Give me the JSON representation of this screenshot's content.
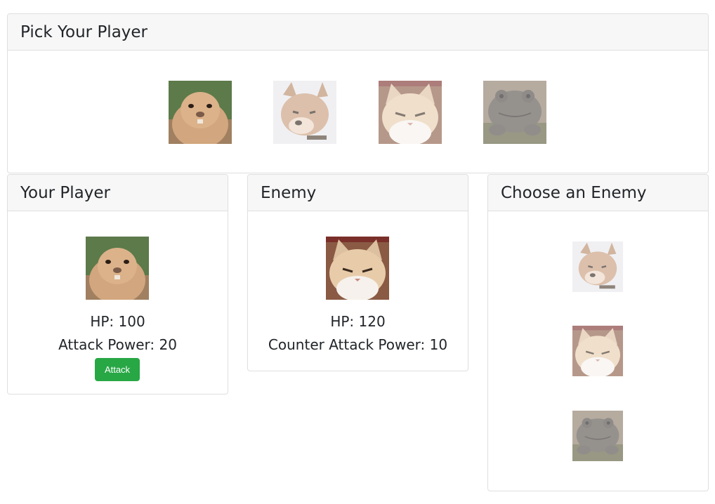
{
  "pick_panel": {
    "title": "Pick Your Player",
    "characters": [
      {
        "icon": "groundhog-icon"
      },
      {
        "icon": "shiba-dog-icon"
      },
      {
        "icon": "grumpy-cat-icon"
      },
      {
        "icon": "frog-icon"
      }
    ]
  },
  "player_panel": {
    "title": "Your Player",
    "icon": "groundhog-icon",
    "hp": "HP: 100",
    "attack_power": "Attack Power: 20",
    "attack_label": "Attack",
    "colors": {
      "attack_button": "#28a745"
    }
  },
  "enemy_panel": {
    "title": "Enemy",
    "icon": "grumpy-cat-icon",
    "hp": "HP: 120",
    "counter_attack_power": "Counter Attack Power: 10"
  },
  "choose_panel": {
    "title": "Choose an Enemy",
    "enemies": [
      {
        "icon": "shiba-dog-icon"
      },
      {
        "icon": "grumpy-cat-icon"
      },
      {
        "icon": "frog-icon"
      }
    ]
  }
}
